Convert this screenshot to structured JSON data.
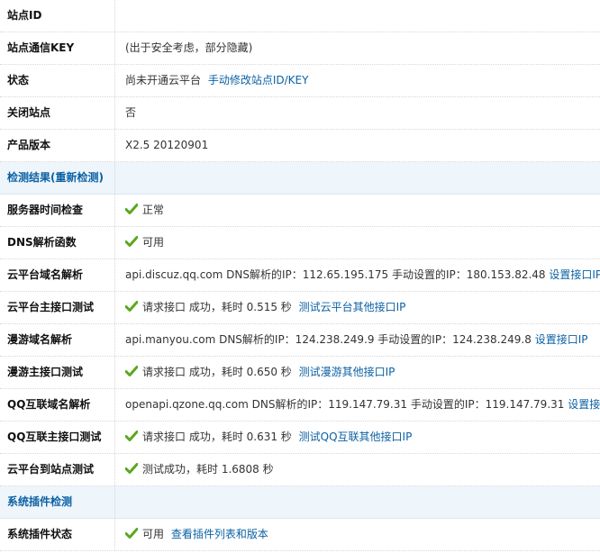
{
  "rows": [
    {
      "label": "站点ID",
      "value": ""
    },
    {
      "label": "站点通信KEY",
      "value": "(出于安全考虑，部分隐藏)"
    },
    {
      "label": "状态",
      "value": "尚未开通云平台",
      "link": "手动修改站点ID/KEY"
    },
    {
      "label": "关闭站点",
      "value": "否"
    },
    {
      "label": "产品版本",
      "value": "X2.5 20120901"
    }
  ],
  "section1": {
    "label": "检测结果(重新检测)"
  },
  "checks": [
    {
      "label": "服务器时间检查",
      "value": "正常"
    },
    {
      "label": "DNS解析函数",
      "value": "可用"
    },
    {
      "label": "云平台域名解析",
      "value": "api.discuz.qq.com DNS解析的IP：112.65.195.175 手动设置的IP：180.153.82.48",
      "link": "设置接口IP"
    },
    {
      "label": "云平台主接口测试",
      "value": "请求接口 成功，耗时 0.515 秒",
      "link": "测试云平台其他接口IP"
    },
    {
      "label": "漫游域名解析",
      "value": "api.manyou.com DNS解析的IP：124.238.249.9 手动设置的IP：124.238.249.8",
      "link": "设置接口IP"
    },
    {
      "label": "漫游主接口测试",
      "value": "请求接口 成功，耗时 0.650 秒",
      "link": "测试漫游其他接口IP"
    },
    {
      "label": "QQ互联域名解析",
      "value": "openapi.qzone.qq.com DNS解析的IP：119.147.79.31 手动设置的IP：119.147.79.31",
      "link": "设置接口IP"
    },
    {
      "label": "QQ互联主接口测试",
      "value": "请求接口 成功，耗时 0.631 秒",
      "link": "测试QQ互联其他接口IP"
    },
    {
      "label": "云平台到站点测试",
      "value": "测试成功，耗时 1.6808 秒"
    }
  ],
  "section2": {
    "label": "系统插件检测"
  },
  "plugins": [
    {
      "label": "系统插件状态",
      "value": "可用",
      "link": "查看插件列表和版本"
    }
  ],
  "colors": {
    "link": "#0b61a4",
    "section_bg": "#eef5fb",
    "check": "#5aa81f"
  },
  "icons": {
    "ok": "check-icon"
  }
}
